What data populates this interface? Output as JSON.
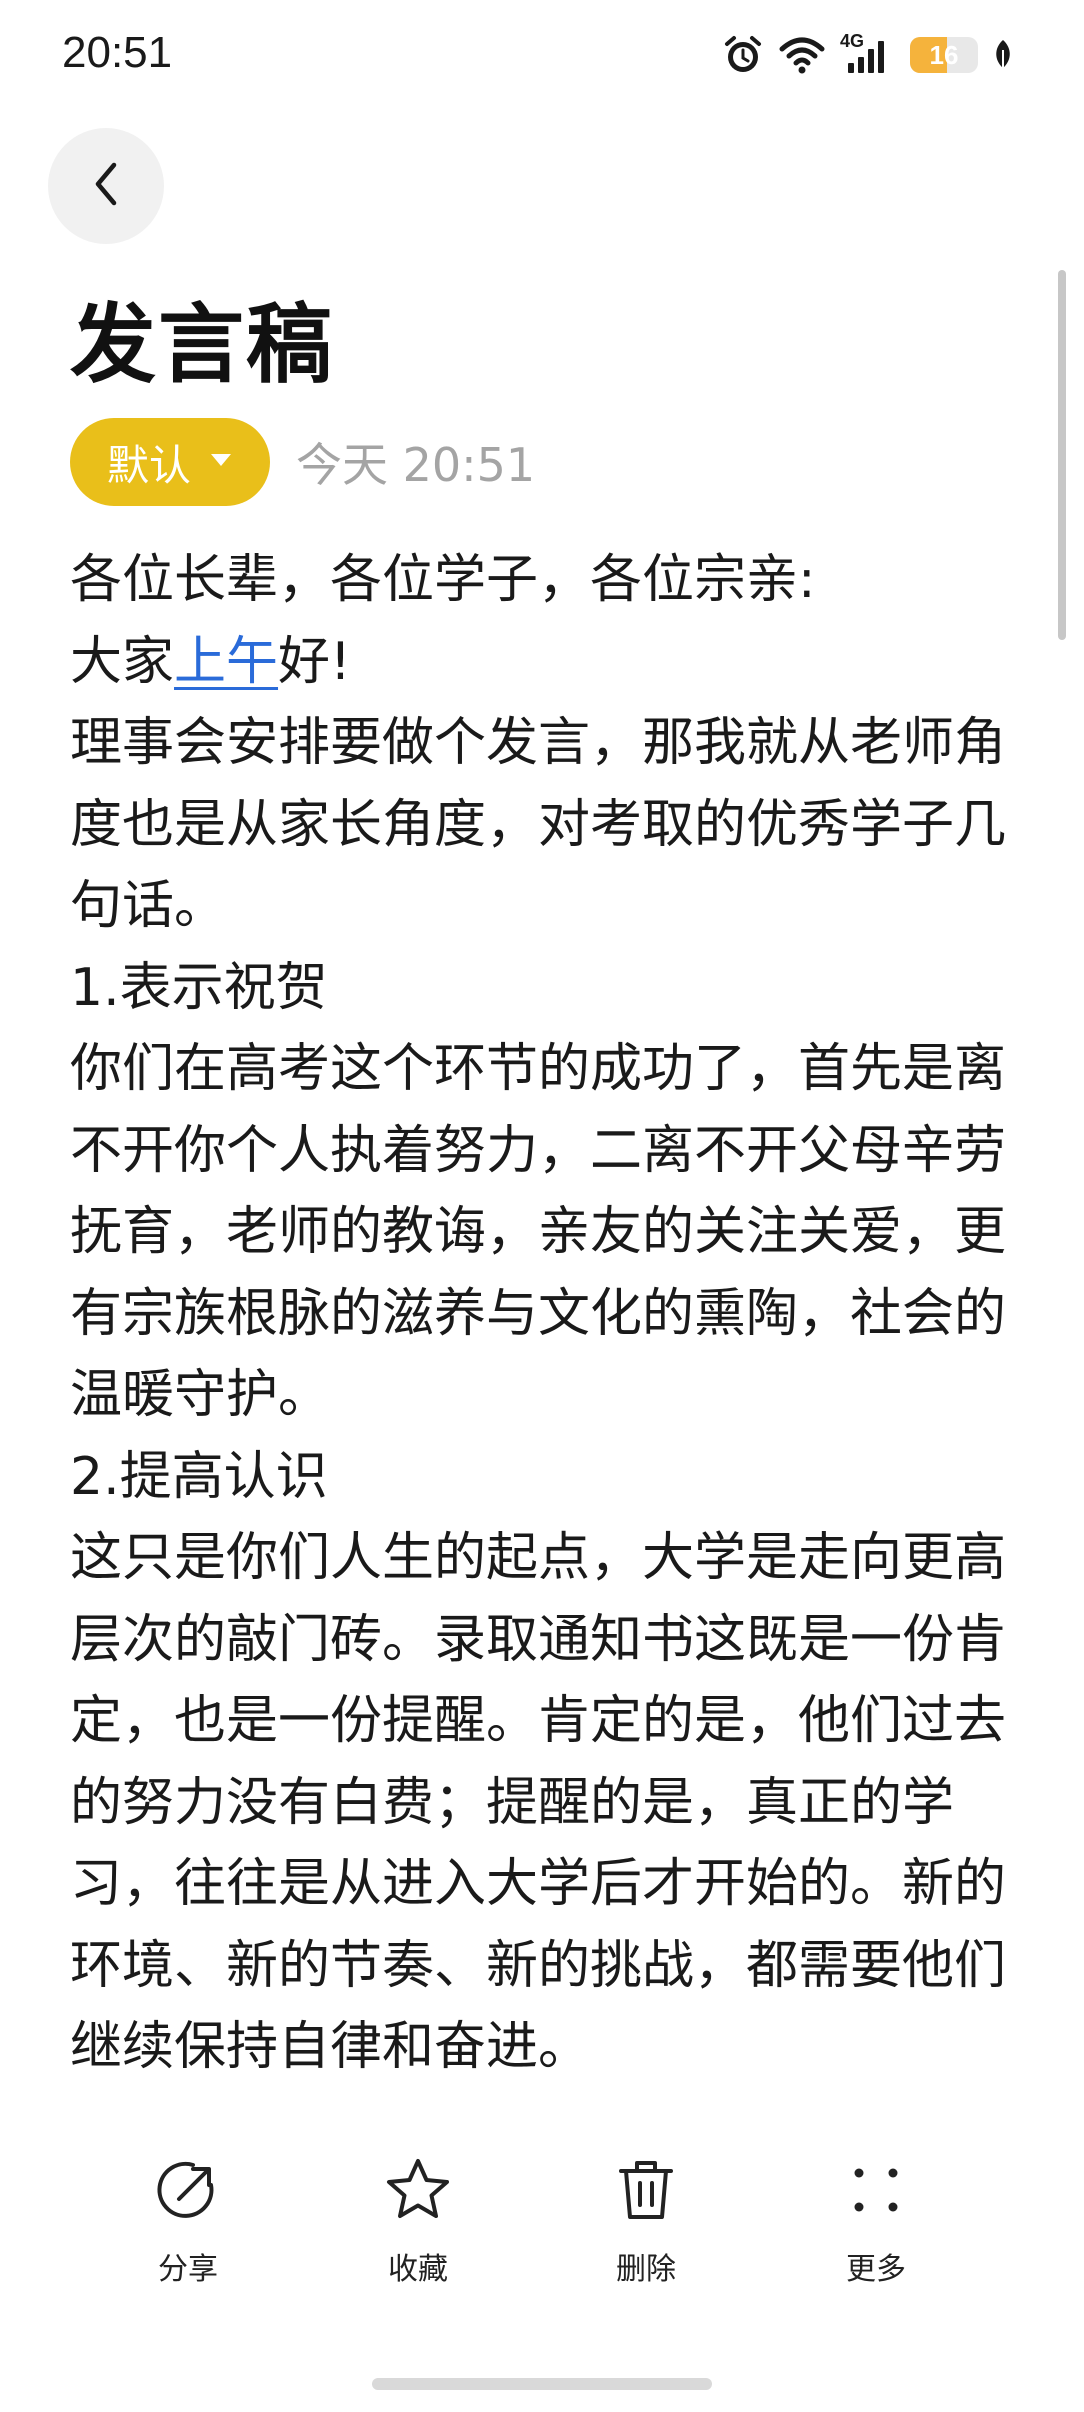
{
  "status_bar": {
    "time": "20:51",
    "network_type": "4G",
    "battery_level": "16",
    "battery_fraction": 0.16,
    "icons": [
      "alarm-icon",
      "wifi-icon",
      "signal-icon",
      "battery-icon",
      "leaf-icon"
    ],
    "battery_color": "#f5b33c"
  },
  "header": {
    "back_icon": "chevron-left-icon"
  },
  "note": {
    "title": "发言稿",
    "folder_label": "默认",
    "folder_color": "#e9bf1a",
    "date": "今天 20:51",
    "lines": {
      "l1": "各位长辈，各位学子，各位宗亲:",
      "l2_before": "大家",
      "l2_link": "上午",
      "l2_after": "好!",
      "l3": "理事会安排要做个发言，那我就从老师角度也是从家长角度，对考取的优秀学子几句话。",
      "l4": "1.表示祝贺",
      "l5": "你们在高考这个环节的成功了，首先是离不开你个人执着努力，二离不开父母辛劳抚育，老师的教诲，亲友的关注关爱，更有宗族根脉的滋养与文化的熏陶，社会的温暖守护。",
      "l6": "2.提高认识",
      "l7": "这只是你们人生的起点，大学是走向更高层次的敲门砖。录取通知书这既是一份肯定，也是一份提醒。肯定的是，他们过去的努力没有白费；提醒的是，真正的学习，往往是从进入大学后才开始的。新的环境、新的节奏、新的挑战，都需要他们继续保持自律和奋进。"
    }
  },
  "toolbar": {
    "share_label": "分享",
    "favorite_label": "收藏",
    "delete_label": "删除",
    "more_label": "更多",
    "icons": [
      "share-icon",
      "star-icon",
      "trash-icon",
      "more-dots-icon"
    ]
  }
}
